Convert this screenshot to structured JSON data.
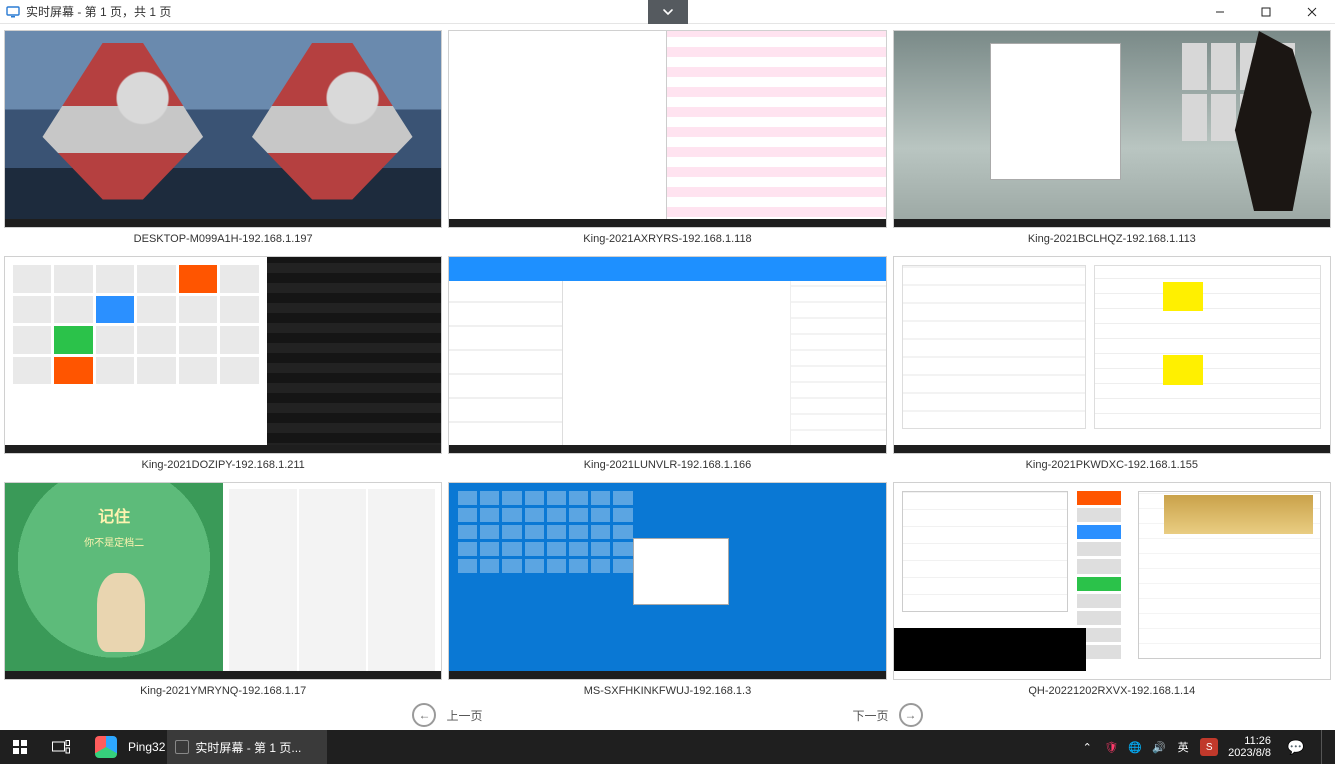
{
  "window": {
    "title": "实时屏幕 - 第 1 页，共 1 页"
  },
  "dropdown_glyph": "⌄",
  "thumbs": [
    {
      "caption": "DESKTOP-M099A1H-192.168.1.197",
      "kind": "ultraman"
    },
    {
      "caption": "King-2021AXRYRS-192.168.1.118",
      "kind": "cad"
    },
    {
      "caption": "King-2021BCLHQZ-192.168.1.113",
      "kind": "anime"
    },
    {
      "caption": "King-2021DOZIPY-192.168.1.211",
      "kind": "browser"
    },
    {
      "caption": "King-2021LUNVLR-192.168.1.166",
      "kind": "chat"
    },
    {
      "caption": "King-2021PKWDXC-192.168.1.155",
      "kind": "table"
    },
    {
      "caption": "King-2021YMRYNQ-192.168.1.17",
      "kind": "green"
    },
    {
      "caption": "MS-SXFHKINKFWUJ-192.168.1.3",
      "kind": "winblue"
    },
    {
      "caption": "QH-20221202RXVX-192.168.1.14",
      "kind": "office"
    }
  ],
  "pager": {
    "prev": "上一页",
    "next": "下一页"
  },
  "green_poster": {
    "title": "记住",
    "subtitle": "你不是定档二"
  },
  "taskbar": {
    "app_name": "Ping32",
    "active_task": "实时屏幕 - 第 1 页...",
    "ime_lang": "英",
    "ime_badge": "S",
    "time": "11:26",
    "date": "2023/8/8"
  },
  "tray_icons": {
    "overflow": "⌃",
    "security": "🛡",
    "network": "🌐",
    "volume": "🔊",
    "notifications": "💬"
  },
  "icons": {
    "win": "⊞",
    "taskview": "▢",
    "thumb_app": "▭",
    "arrow_left": "←",
    "arrow_right": "→"
  }
}
